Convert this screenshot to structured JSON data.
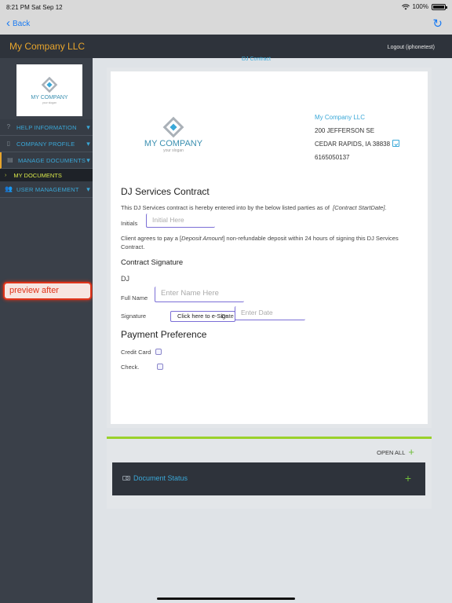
{
  "status_bar": {
    "time_date": "8:21 PM  Sat Sep 12",
    "battery": "100%"
  },
  "nav": {
    "back_label": "Back"
  },
  "header": {
    "company": "My Company LLC",
    "logout": "Logout (iphonetest)"
  },
  "logo": {
    "title": "MY COMPANY",
    "tagline": "your slogan"
  },
  "sidebar": {
    "items": [
      {
        "label": "HELP INFORMATION",
        "icon": "help-icon"
      },
      {
        "label": "COMPANY PROFILE",
        "icon": "phone-icon"
      },
      {
        "label": "MANAGE DOCUMENTS",
        "icon": "document-icon"
      },
      {
        "label": "USER MANAGEMENT",
        "icon": "users-icon"
      }
    ],
    "sub_item": "MY DOCUMENTS",
    "preview_button": "preview after"
  },
  "document": {
    "title_tab": "DJ Contract",
    "company_name": "My Company LLC",
    "address1": "200 JEFFERSON SE",
    "address2": "CEDAR RAPIDS, IA 38838",
    "phone": "6165050137",
    "heading": "DJ Services Contract",
    "intro_text": "This DJ Services contract is hereby entered into by the below listed parties as of",
    "intro_var": "[Contract StartDate]",
    "initials_label": "Initials",
    "initials_placeholder": "Initial Here",
    "deposit_text_a": "Client agrees to pay a [",
    "deposit_var": "Deposit Amount",
    "deposit_text_b": "] non-refundable deposit within 24 hours of signing this DJ Services",
    "deposit_text_c": "Contract.",
    "signature_heading": "Contract Signature",
    "dj_label": "DJ",
    "fullname_label": "Full Name",
    "fullname_placeholder": "Enter Name Here",
    "signature_label": "Signature",
    "esign_button": "Click here to e-Sign",
    "date_label": "Date",
    "date_placeholder": "Enter Date",
    "payment_heading": "Payment Preference",
    "credit_card_label": "Credit Card",
    "check_label": "Check."
  },
  "accordion": {
    "open_all": "OPEN ALL",
    "item_label": "Document Status"
  },
  "colors": {
    "accent_blue": "#3aa8d8",
    "brand_orange": "#e8a52c",
    "green": "#6fbd3a",
    "alert_red": "#e0341a"
  }
}
